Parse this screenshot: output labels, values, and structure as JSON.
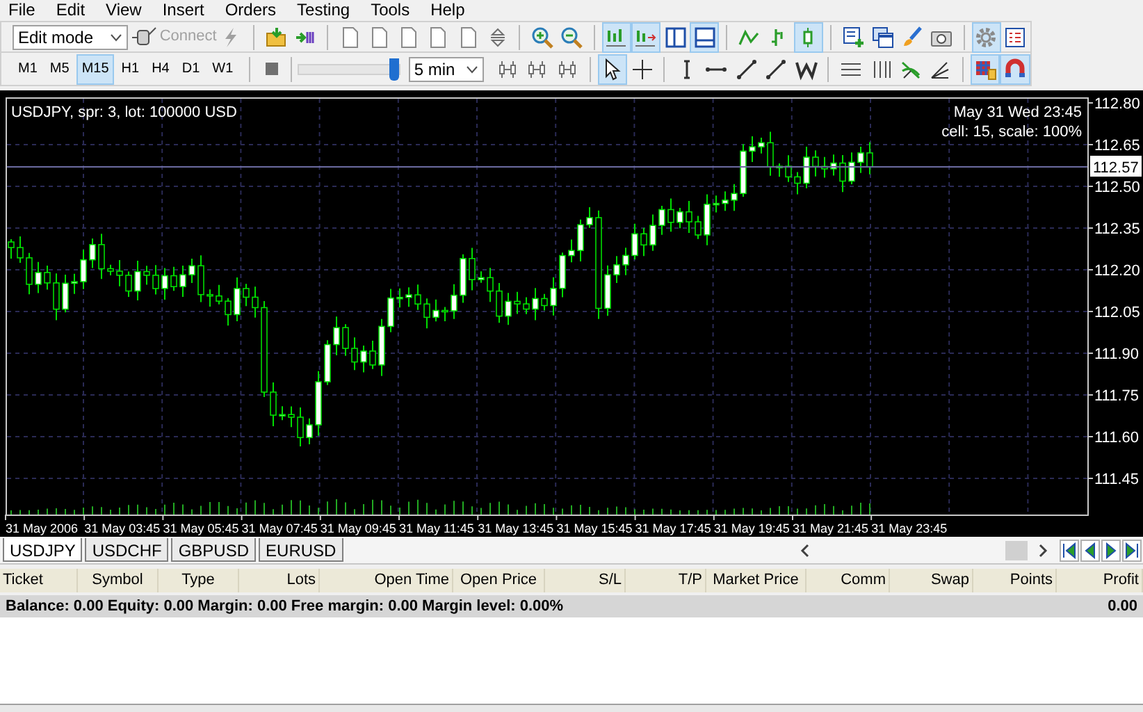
{
  "menu": [
    "File",
    "Edit",
    "View",
    "Insert",
    "Orders",
    "Testing",
    "Tools",
    "Help"
  ],
  "toolbar_top": {
    "mode_combo": {
      "value": "Edit mode"
    },
    "connect": {
      "label": "Connect",
      "disabled": true
    },
    "tools": [
      {
        "kind": "lightning",
        "selected": false
      },
      {
        "kind": "sep"
      },
      {
        "kind": "folder",
        "selected": false
      },
      {
        "kind": "arrowbars",
        "selected": false
      },
      {
        "kind": "sep"
      },
      {
        "kind": "doc",
        "selected": false
      },
      {
        "kind": "doc",
        "selected": false
      },
      {
        "kind": "doc",
        "selected": false
      },
      {
        "kind": "doc",
        "selected": false
      },
      {
        "kind": "doc",
        "selected": false
      },
      {
        "kind": "updown",
        "selected": false
      },
      {
        "kind": "sep"
      },
      {
        "kind": "zoomin",
        "selected": false
      },
      {
        "kind": "zoomout",
        "selected": false
      },
      {
        "kind": "sep"
      },
      {
        "kind": "bars",
        "selected": true
      },
      {
        "kind": "shift",
        "selected": true
      },
      {
        "kind": "panel_left",
        "selected": false
      },
      {
        "kind": "panel_bottom",
        "selected": true
      },
      {
        "kind": "sep"
      },
      {
        "kind": "line",
        "selected": false
      },
      {
        "kind": "bar",
        "selected": false
      },
      {
        "kind": "candle",
        "selected": true
      },
      {
        "kind": "sep"
      },
      {
        "kind": "neworder",
        "selected": false
      },
      {
        "kind": "windows",
        "selected": false
      },
      {
        "kind": "brush",
        "selected": false
      },
      {
        "kind": "camera",
        "selected": false
      },
      {
        "kind": "sep"
      },
      {
        "kind": "gear",
        "selected": true
      },
      {
        "kind": "list",
        "selected": false
      }
    ]
  },
  "toolbar_bottom": {
    "timeframes": [
      {
        "label": "M1",
        "selected": false
      },
      {
        "label": "M5",
        "selected": false
      },
      {
        "label": "M15",
        "selected": true
      },
      {
        "label": "H1",
        "selected": false
      },
      {
        "label": "H4",
        "selected": false
      },
      {
        "label": "D1",
        "selected": false
      },
      {
        "label": "W1",
        "selected": false
      }
    ],
    "speed_slider": {
      "level": 0.95
    },
    "step_combo": {
      "value": "5 min"
    },
    "tools": [
      {
        "kind": "period",
        "selected": false
      },
      {
        "kind": "period",
        "selected": false
      },
      {
        "kind": "period",
        "selected": false
      },
      {
        "kind": "sep"
      },
      {
        "kind": "cursor",
        "selected": true
      },
      {
        "kind": "cross",
        "selected": false
      },
      {
        "kind": "sep"
      },
      {
        "kind": "vline",
        "selected": false
      },
      {
        "kind": "hline",
        "selected": false
      },
      {
        "kind": "trend",
        "selected": false
      },
      {
        "kind": "trend",
        "selected": false
      },
      {
        "kind": "wave",
        "selected": false
      },
      {
        "kind": "sep"
      },
      {
        "kind": "hlines",
        "selected": false
      },
      {
        "kind": "vlines",
        "selected": false
      },
      {
        "kind": "fan",
        "selected": false
      },
      {
        "kind": "angle",
        "selected": false
      },
      {
        "kind": "sep"
      },
      {
        "kind": "grid",
        "selected": true
      },
      {
        "kind": "magnet",
        "selected": true
      }
    ]
  },
  "chart": {
    "info": "USDJPY, spr: 3, lot: 100000 USD",
    "time_info": "May 31 Wed 23:45",
    "scale_info": "cell: 15, scale: 100%",
    "price_ticks": [
      "112.80",
      "112.65",
      "112.50",
      "112.35",
      "112.20",
      "112.05",
      "111.90",
      "111.75",
      "111.60",
      "111.45"
    ],
    "current_price": "112.57",
    "time_ticks": [
      "31 May 2006",
      "31 May 03:45",
      "31 May 05:45",
      "31 May 07:45",
      "31 May 09:45",
      "31 May 11:45",
      "31 May 13:45",
      "31 May 15:45",
      "31 May 17:45",
      "31 May 19:45",
      "31 May 21:45",
      "31 May 23:45"
    ]
  },
  "symbol_tabs": [
    {
      "label": "USDJPY",
      "selected": true
    },
    {
      "label": "USDCHF",
      "selected": false
    },
    {
      "label": "GBPUSD",
      "selected": false
    },
    {
      "label": "EURUSD",
      "selected": false
    }
  ],
  "terminal": {
    "columns": [
      {
        "label": "Ticket"
      },
      {
        "label": "Symbol"
      },
      {
        "label": "Type"
      },
      {
        "label": "Lots"
      },
      {
        "label": "Open Time"
      },
      {
        "label": "Open Price"
      },
      {
        "label": "S/L"
      },
      {
        "label": "T/P"
      },
      {
        "label": "Market Price"
      },
      {
        "label": "Comm"
      },
      {
        "label": "Swap"
      },
      {
        "label": "Points"
      },
      {
        "label": "Profit"
      }
    ],
    "balance": "Balance: 0.00 Equity: 0.00 Margin: 0.00 Free margin: 0.00 Margin level: 0.00%",
    "profit": "0.00"
  }
}
